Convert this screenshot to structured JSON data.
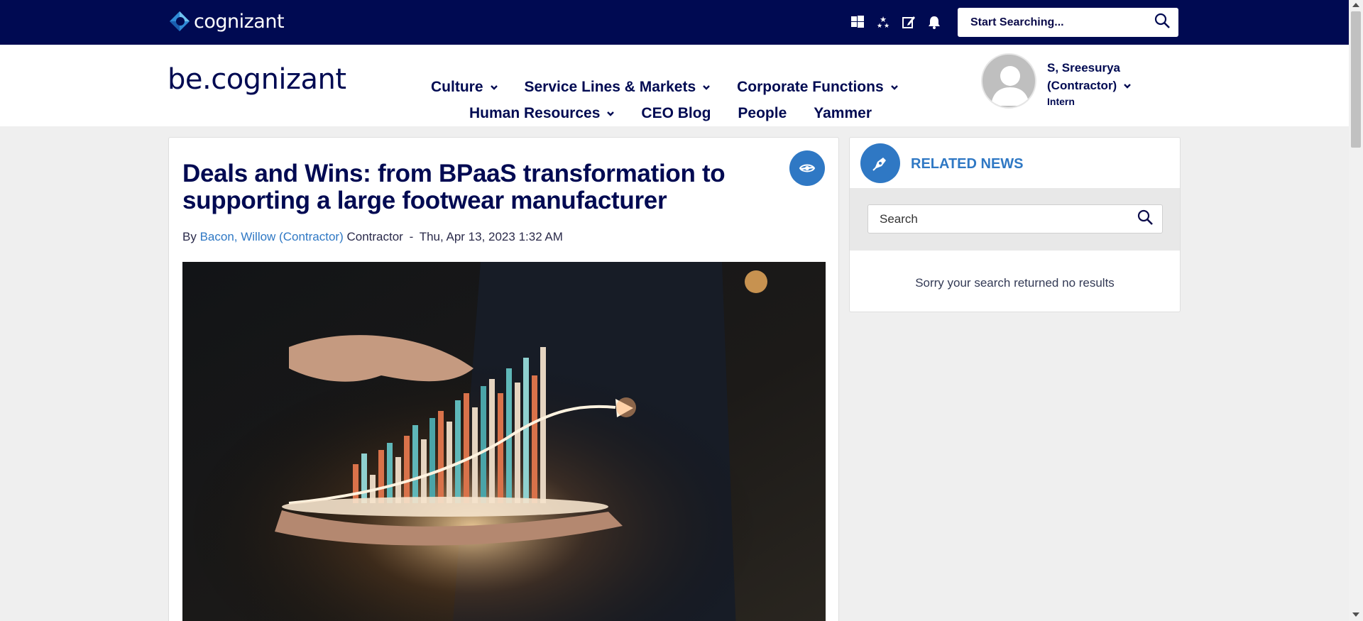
{
  "topbar": {
    "logo_text": "cognizant",
    "icons": [
      "windows-icon",
      "stars-icon",
      "edit-icon",
      "bell-icon"
    ],
    "search_placeholder": "Start Searching..."
  },
  "header": {
    "brand": "be.cognizant",
    "nav_row1": [
      {
        "label": "Culture",
        "dropdown": true
      },
      {
        "label": "Service Lines & Markets",
        "dropdown": true
      },
      {
        "label": "Corporate Functions",
        "dropdown": true
      }
    ],
    "nav_row2": [
      {
        "label": "Human Resources",
        "dropdown": true
      },
      {
        "label": "CEO Blog",
        "dropdown": false
      },
      {
        "label": "People",
        "dropdown": false
      },
      {
        "label": "Yammer",
        "dropdown": false
      }
    ],
    "user": {
      "name_line1": "S, Sreesurya",
      "name_line2": "(Contractor)",
      "role": "Intern"
    }
  },
  "article": {
    "title": "Deals and Wins: from BPaaS transformation to supporting a large footwear manufacturer",
    "by": "By",
    "author": "Bacon, Willow (Contractor)",
    "author_type": "Contractor",
    "separator": "-",
    "date": "Thu, Apr 13, 2023 1:32 AM"
  },
  "related": {
    "title": "RELATED NEWS",
    "search_placeholder": "Search",
    "empty_message": "Sorry your search returned no results"
  },
  "colors": {
    "topbar_bg": "#000a52",
    "accent_blue": "#2f78c4",
    "page_bg": "#efefef"
  }
}
